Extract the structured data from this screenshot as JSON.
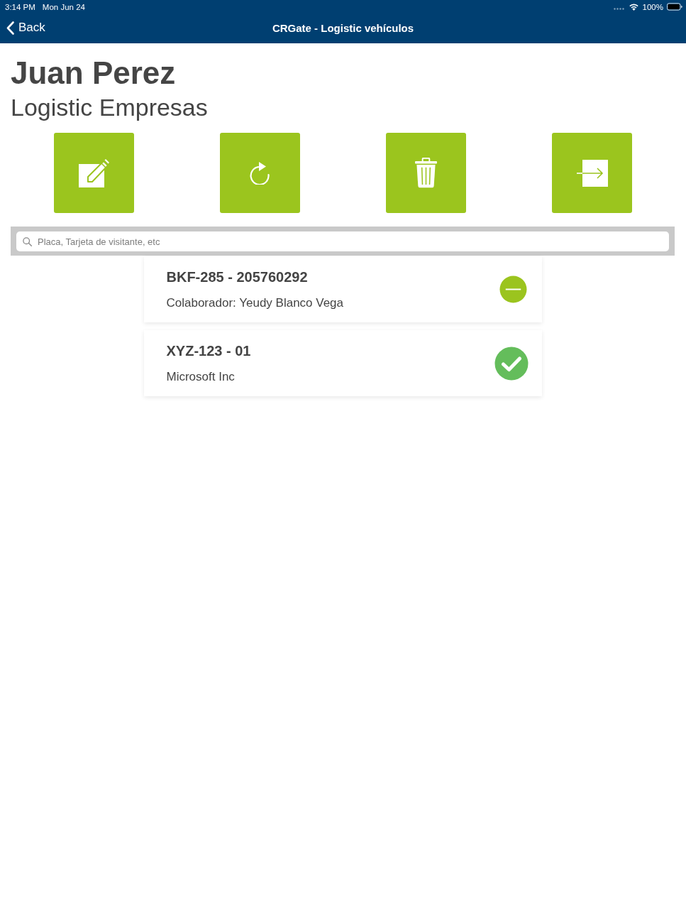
{
  "status_bar": {
    "time": "3:14 PM",
    "date": "Mon Jun 24",
    "battery": "100%"
  },
  "nav_bar": {
    "back": "Back",
    "title": "CRGate - Logistic vehículos"
  },
  "header": {
    "name": "Juan Perez",
    "subtitle": "Logistic Empresas"
  },
  "actions": [
    {
      "kind": "edit"
    },
    {
      "kind": "refresh"
    },
    {
      "kind": "delete"
    },
    {
      "kind": "exit"
    }
  ],
  "search": {
    "placeholder": "Placa, Tarjeta de visitante, etc"
  },
  "entries": [
    {
      "title": "BKF-285 - 205760292",
      "subtitle": "Colaborador: Yeudy Blanco Vega",
      "kind": "minus",
      "color": "#9bc41e"
    },
    {
      "title": "XYZ-123 - 01",
      "subtitle": "Microsoft Inc",
      "kind": "check",
      "color": "#64bd5b"
    }
  ]
}
